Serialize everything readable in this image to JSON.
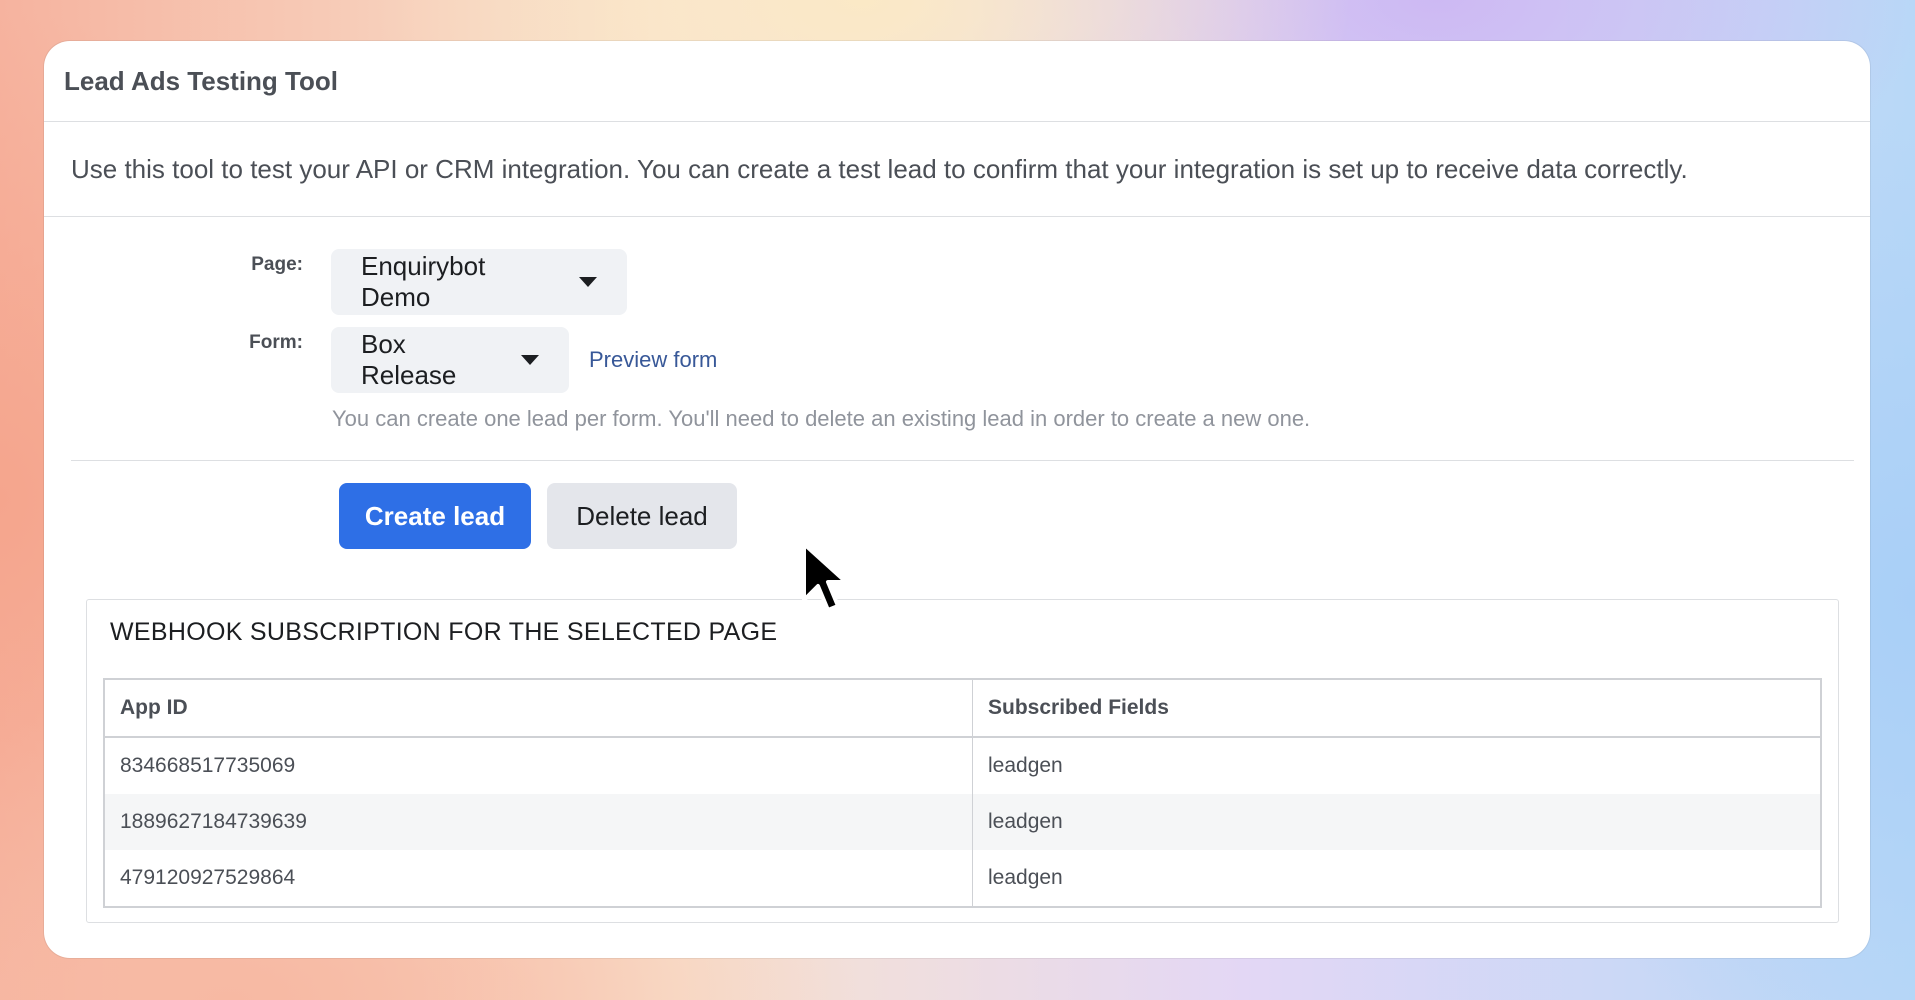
{
  "window": {
    "title": "Lead Ads Testing Tool"
  },
  "intro": {
    "description": "Use this tool to test your API or CRM integration. You can create a test lead to confirm that your integration is set up to receive data correctly."
  },
  "form": {
    "page_label": "Page:",
    "page_value": "Enquirybot Demo",
    "form_label": "Form:",
    "form_value": "Box Release",
    "preview_link": "Preview form",
    "helper_text": "You can create one lead per form. You'll need to delete an existing lead in order to create a new one."
  },
  "actions": {
    "create_label": "Create lead",
    "delete_label": "Delete lead"
  },
  "webhook": {
    "title": "WEBHOOK SUBSCRIPTION FOR THE SELECTED PAGE",
    "columns": [
      "App ID",
      "Subscribed Fields"
    ],
    "rows": [
      {
        "app_id": "834668517735069",
        "fields": "leadgen"
      },
      {
        "app_id": "1889627184739639",
        "fields": "leadgen"
      },
      {
        "app_id": "479120927529864",
        "fields": "leadgen"
      }
    ]
  },
  "icons": {
    "dropdown": "caret-down-icon",
    "pointer": "mouse-cursor-icon"
  },
  "colors": {
    "primary_button": "#2e6fe6",
    "link": "#385898"
  }
}
